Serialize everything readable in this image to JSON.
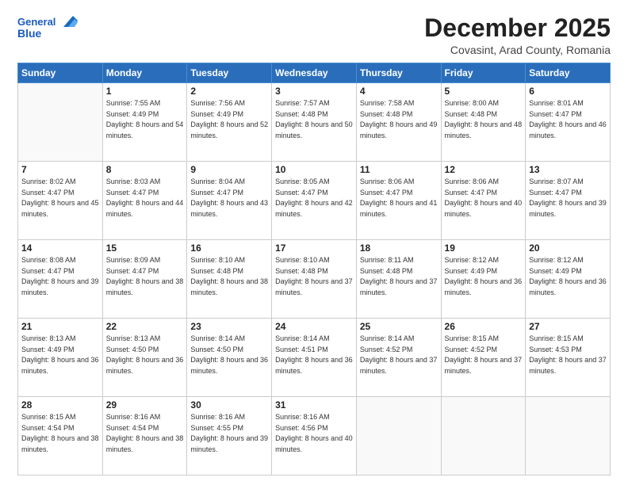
{
  "header": {
    "logo_line1": "General",
    "logo_line2": "Blue",
    "month": "December 2025",
    "location": "Covasint, Arad County, Romania"
  },
  "weekdays": [
    "Sunday",
    "Monday",
    "Tuesday",
    "Wednesday",
    "Thursday",
    "Friday",
    "Saturday"
  ],
  "weeks": [
    [
      {
        "day": "",
        "sunrise": "",
        "sunset": "",
        "daylight": ""
      },
      {
        "day": "1",
        "sunrise": "Sunrise: 7:55 AM",
        "sunset": "Sunset: 4:49 PM",
        "daylight": "Daylight: 8 hours and 54 minutes."
      },
      {
        "day": "2",
        "sunrise": "Sunrise: 7:56 AM",
        "sunset": "Sunset: 4:49 PM",
        "daylight": "Daylight: 8 hours and 52 minutes."
      },
      {
        "day": "3",
        "sunrise": "Sunrise: 7:57 AM",
        "sunset": "Sunset: 4:48 PM",
        "daylight": "Daylight: 8 hours and 50 minutes."
      },
      {
        "day": "4",
        "sunrise": "Sunrise: 7:58 AM",
        "sunset": "Sunset: 4:48 PM",
        "daylight": "Daylight: 8 hours and 49 minutes."
      },
      {
        "day": "5",
        "sunrise": "Sunrise: 8:00 AM",
        "sunset": "Sunset: 4:48 PM",
        "daylight": "Daylight: 8 hours and 48 minutes."
      },
      {
        "day": "6",
        "sunrise": "Sunrise: 8:01 AM",
        "sunset": "Sunset: 4:47 PM",
        "daylight": "Daylight: 8 hours and 46 minutes."
      }
    ],
    [
      {
        "day": "7",
        "sunrise": "Sunrise: 8:02 AM",
        "sunset": "Sunset: 4:47 PM",
        "daylight": "Daylight: 8 hours and 45 minutes."
      },
      {
        "day": "8",
        "sunrise": "Sunrise: 8:03 AM",
        "sunset": "Sunset: 4:47 PM",
        "daylight": "Daylight: 8 hours and 44 minutes."
      },
      {
        "day": "9",
        "sunrise": "Sunrise: 8:04 AM",
        "sunset": "Sunset: 4:47 PM",
        "daylight": "Daylight: 8 hours and 43 minutes."
      },
      {
        "day": "10",
        "sunrise": "Sunrise: 8:05 AM",
        "sunset": "Sunset: 4:47 PM",
        "daylight": "Daylight: 8 hours and 42 minutes."
      },
      {
        "day": "11",
        "sunrise": "Sunrise: 8:06 AM",
        "sunset": "Sunset: 4:47 PM",
        "daylight": "Daylight: 8 hours and 41 minutes."
      },
      {
        "day": "12",
        "sunrise": "Sunrise: 8:06 AM",
        "sunset": "Sunset: 4:47 PM",
        "daylight": "Daylight: 8 hours and 40 minutes."
      },
      {
        "day": "13",
        "sunrise": "Sunrise: 8:07 AM",
        "sunset": "Sunset: 4:47 PM",
        "daylight": "Daylight: 8 hours and 39 minutes."
      }
    ],
    [
      {
        "day": "14",
        "sunrise": "Sunrise: 8:08 AM",
        "sunset": "Sunset: 4:47 PM",
        "daylight": "Daylight: 8 hours and 39 minutes."
      },
      {
        "day": "15",
        "sunrise": "Sunrise: 8:09 AM",
        "sunset": "Sunset: 4:47 PM",
        "daylight": "Daylight: 8 hours and 38 minutes."
      },
      {
        "day": "16",
        "sunrise": "Sunrise: 8:10 AM",
        "sunset": "Sunset: 4:48 PM",
        "daylight": "Daylight: 8 hours and 38 minutes."
      },
      {
        "day": "17",
        "sunrise": "Sunrise: 8:10 AM",
        "sunset": "Sunset: 4:48 PM",
        "daylight": "Daylight: 8 hours and 37 minutes."
      },
      {
        "day": "18",
        "sunrise": "Sunrise: 8:11 AM",
        "sunset": "Sunset: 4:48 PM",
        "daylight": "Daylight: 8 hours and 37 minutes."
      },
      {
        "day": "19",
        "sunrise": "Sunrise: 8:12 AM",
        "sunset": "Sunset: 4:49 PM",
        "daylight": "Daylight: 8 hours and 36 minutes."
      },
      {
        "day": "20",
        "sunrise": "Sunrise: 8:12 AM",
        "sunset": "Sunset: 4:49 PM",
        "daylight": "Daylight: 8 hours and 36 minutes."
      }
    ],
    [
      {
        "day": "21",
        "sunrise": "Sunrise: 8:13 AM",
        "sunset": "Sunset: 4:49 PM",
        "daylight": "Daylight: 8 hours and 36 minutes."
      },
      {
        "day": "22",
        "sunrise": "Sunrise: 8:13 AM",
        "sunset": "Sunset: 4:50 PM",
        "daylight": "Daylight: 8 hours and 36 minutes."
      },
      {
        "day": "23",
        "sunrise": "Sunrise: 8:14 AM",
        "sunset": "Sunset: 4:50 PM",
        "daylight": "Daylight: 8 hours and 36 minutes."
      },
      {
        "day": "24",
        "sunrise": "Sunrise: 8:14 AM",
        "sunset": "Sunset: 4:51 PM",
        "daylight": "Daylight: 8 hours and 36 minutes."
      },
      {
        "day": "25",
        "sunrise": "Sunrise: 8:14 AM",
        "sunset": "Sunset: 4:52 PM",
        "daylight": "Daylight: 8 hours and 37 minutes."
      },
      {
        "day": "26",
        "sunrise": "Sunrise: 8:15 AM",
        "sunset": "Sunset: 4:52 PM",
        "daylight": "Daylight: 8 hours and 37 minutes."
      },
      {
        "day": "27",
        "sunrise": "Sunrise: 8:15 AM",
        "sunset": "Sunset: 4:53 PM",
        "daylight": "Daylight: 8 hours and 37 minutes."
      }
    ],
    [
      {
        "day": "28",
        "sunrise": "Sunrise: 8:15 AM",
        "sunset": "Sunset: 4:54 PM",
        "daylight": "Daylight: 8 hours and 38 minutes."
      },
      {
        "day": "29",
        "sunrise": "Sunrise: 8:16 AM",
        "sunset": "Sunset: 4:54 PM",
        "daylight": "Daylight: 8 hours and 38 minutes."
      },
      {
        "day": "30",
        "sunrise": "Sunrise: 8:16 AM",
        "sunset": "Sunset: 4:55 PM",
        "daylight": "Daylight: 8 hours and 39 minutes."
      },
      {
        "day": "31",
        "sunrise": "Sunrise: 8:16 AM",
        "sunset": "Sunset: 4:56 PM",
        "daylight": "Daylight: 8 hours and 40 minutes."
      },
      {
        "day": "",
        "sunrise": "",
        "sunset": "",
        "daylight": ""
      },
      {
        "day": "",
        "sunrise": "",
        "sunset": "",
        "daylight": ""
      },
      {
        "day": "",
        "sunrise": "",
        "sunset": "",
        "daylight": ""
      }
    ]
  ]
}
